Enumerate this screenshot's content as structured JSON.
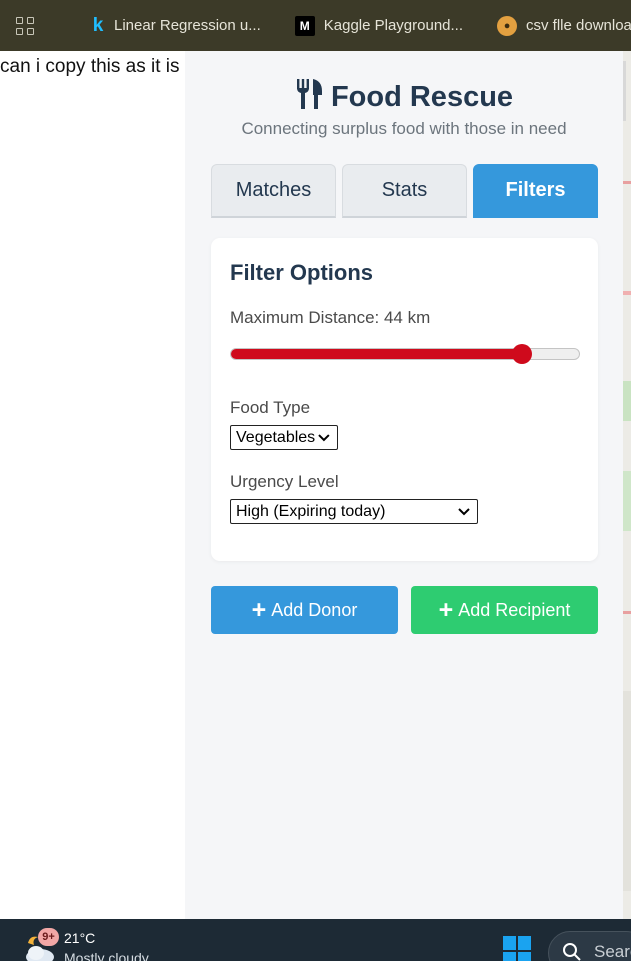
{
  "bookmarks": [
    {
      "icon": "kaggle-k-icon",
      "label": "Linear Regression u..."
    },
    {
      "icon": "medium-icon",
      "label": "Kaggle Playground..."
    },
    {
      "icon": "csv-icon",
      "label": "csv flle download"
    }
  ],
  "left_text": "can i copy this as it is",
  "app": {
    "title": "Food Rescue",
    "title_icon": "utensils-icon",
    "subtitle": "Connecting surplus food with those in need",
    "tabs": [
      {
        "label": "Matches",
        "active": false
      },
      {
        "label": "Stats",
        "active": false
      },
      {
        "label": "Filters",
        "active": true
      }
    ],
    "filters": {
      "title": "Filter Options",
      "distance_label": "Maximum Distance: 44 km",
      "distance_fraction": 0.835,
      "food_type_label": "Food Type",
      "food_type_value": "Vegetables",
      "urgency_label": "Urgency Level",
      "urgency_value": "High (Expiring today)"
    },
    "buttons": {
      "plus": "+",
      "add_donor": "Add Donor",
      "add_recipient": "Add Recipient"
    }
  },
  "colors": {
    "primary": "#3598dc",
    "success": "#2ecc71",
    "slider": "#cf0a1c",
    "heading": "#23384f"
  },
  "taskbar": {
    "notification_badge": "9+",
    "temperature": "21°C",
    "condition": "Mostly cloudy",
    "search_text": "Search"
  }
}
